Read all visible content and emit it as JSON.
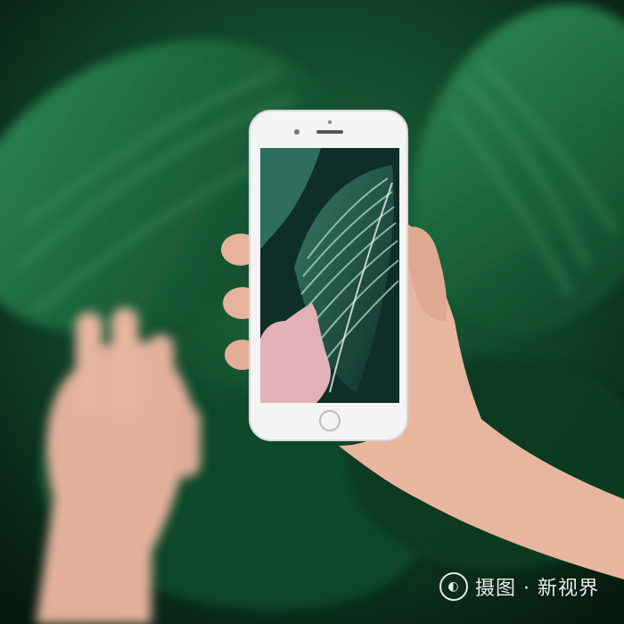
{
  "scene": {
    "description_visible": "",
    "colors": {
      "leaf_dark": "#0c3a22",
      "leaf_mid": "#16633a",
      "leaf_light": "#3fa06a",
      "skin": "#e9b9a1",
      "phone_body": "#f4f4f4"
    }
  },
  "watermark": {
    "icon": "camera-aperture-icon",
    "text": "摄图 · 新视界"
  }
}
